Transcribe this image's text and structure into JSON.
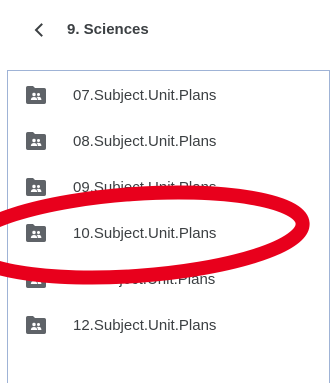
{
  "header": {
    "back_icon": "chevron-left-icon",
    "title": "9. Sciences"
  },
  "list": {
    "folder_icon": "shared-folder-icon",
    "items": [
      {
        "label": "07.Subject.Unit.Plans"
      },
      {
        "label": "08.Subject.Unit.Plans"
      },
      {
        "label": "09.Subject.Unit.Plans"
      },
      {
        "label": "10.Subject.Unit.Plans"
      },
      {
        "label": "11.Subject.Unit.Plans"
      },
      {
        "label": "12.Subject.Unit.Plans"
      }
    ]
  },
  "colors": {
    "text": "#3c4043",
    "icon": "#5f6368",
    "panel_border": "#9fb3d6",
    "annotation": "#e8001c"
  }
}
